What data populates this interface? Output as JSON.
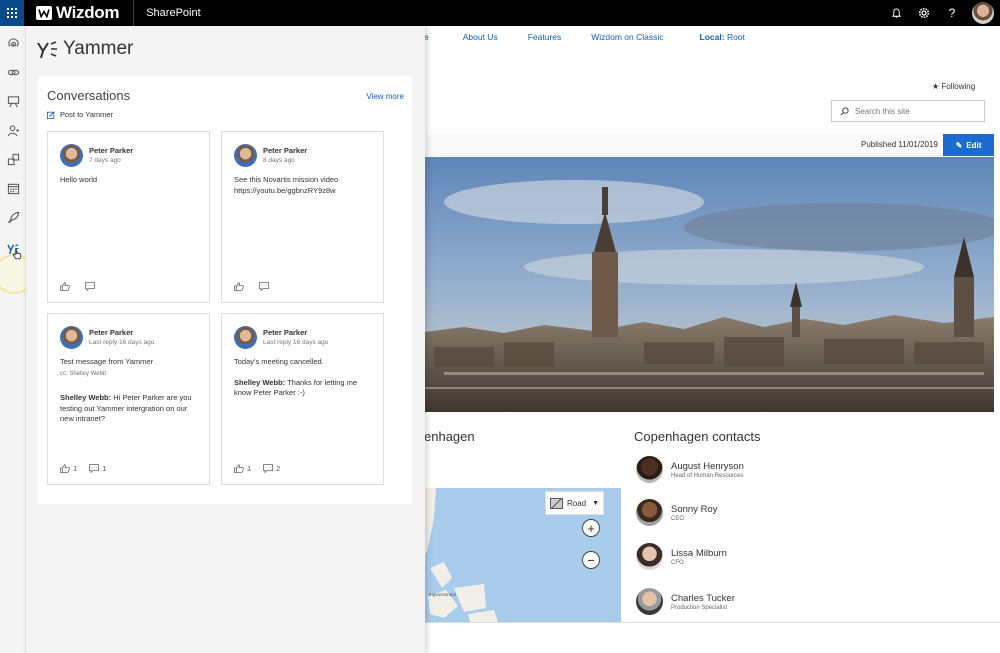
{
  "topbar": {
    "brand": "Wizdom",
    "suite_title": "SharePoint",
    "icons": [
      "waffle-icon",
      "bell-icon",
      "gear-icon",
      "help-icon"
    ],
    "help_label": "?"
  },
  "site": {
    "nav": [
      "e",
      "About Us",
      "Features",
      "Wizdom on Classic"
    ],
    "nav_local_label": "Local:",
    "nav_local_value": "Root",
    "following": "Following",
    "search_placeholder": "Search this site",
    "published": "Published 11/01/2019",
    "edit": "Edit",
    "map_section_title": "enhagen",
    "contacts_title": "Copenhagen contacts",
    "map_road": "Road",
    "map_zoom_in": "+",
    "map_zoom_out": "−",
    "map_label": "Ingvarsstraen",
    "contacts": [
      {
        "name": "August Henryson",
        "role": "Head of Human Resources"
      },
      {
        "name": "Sonny Roy",
        "role": "CEO"
      },
      {
        "name": "Lissa Milburn",
        "role": "CFO"
      },
      {
        "name": "Charles Tucker",
        "role": "Production Specialist"
      }
    ]
  },
  "panel": {
    "title": "Yammer",
    "conversations_title": "Conversations",
    "view_more": "View more",
    "post_to_yammer": "Post to Yammer",
    "posts": [
      {
        "author": "Peter Parker",
        "meta": "7 days ago",
        "body": "Hello world",
        "cc": "",
        "reply_author": "",
        "reply_text": "",
        "likes": "",
        "replies": ""
      },
      {
        "author": "Peter Parker",
        "meta": "8 days ago",
        "body": "See this Novartis mission video https://youtu.be/ggbnzRY9z8w",
        "cc": "",
        "reply_author": "",
        "reply_text": "",
        "likes": "",
        "replies": ""
      },
      {
        "author": "Peter Parker",
        "meta": "Last reply 16 days ago",
        "body": "Test message from Yammer",
        "cc": "cc: Shelley Webb",
        "reply_author": "Shelley Webb:",
        "reply_text": " Hi Peter Parker are you testing out Yammer intergration on our new intranet?",
        "likes": "1",
        "replies": "1"
      },
      {
        "author": "Peter Parker",
        "meta": "Last reply 16 days ago",
        "body": "Today's meeting cancelled.",
        "cc": "",
        "reply_author": "Shelley Webb:",
        "reply_text": " Thanks for letting me know Peter Parker :-)",
        "likes": "1",
        "replies": "2"
      }
    ]
  },
  "rail": {
    "icons": [
      "broadcast-icon",
      "links-icon",
      "presentation-icon",
      "people-icon",
      "apps-icon",
      "calendar-icon",
      "rocket-icon",
      "yammer-icon"
    ]
  },
  "colors": {
    "topbar": "#000000",
    "waffle": "#0a4a8a",
    "link": "#1a5fa8",
    "edit_button": "#1c6bd1",
    "map_water": "#a9ccec"
  }
}
